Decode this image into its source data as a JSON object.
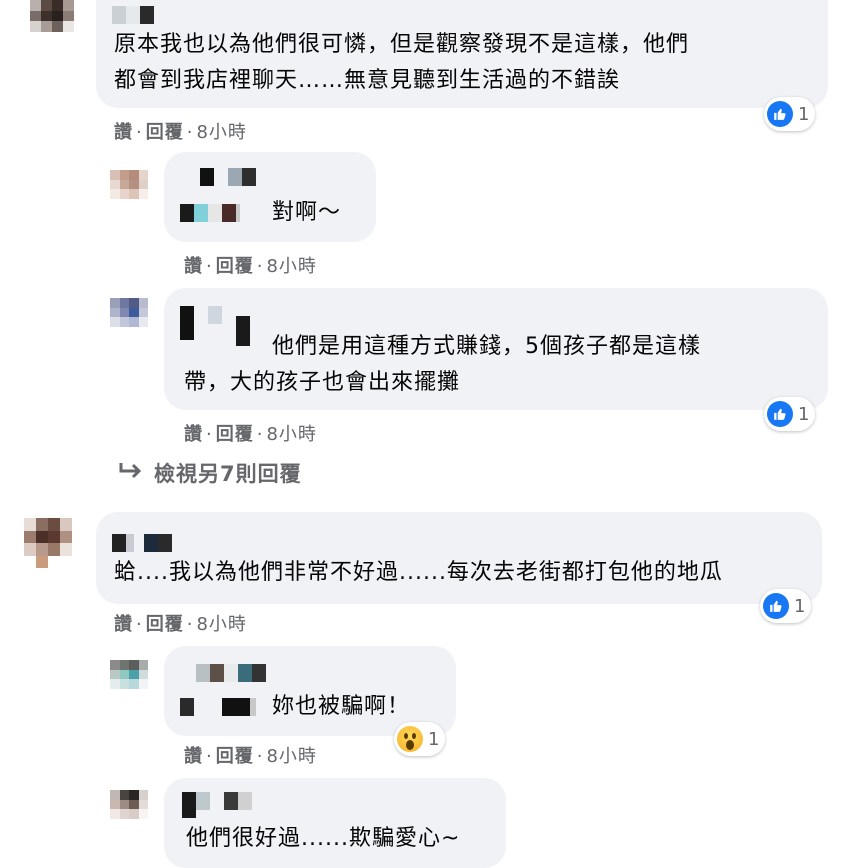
{
  "actions": {
    "like": "讚",
    "reply": "回覆",
    "dot": "·"
  },
  "comments": [
    {
      "line1": "原本我也以為他們很可憐，但是觀察發現不是這樣，他們",
      "line2": "都會到我店裡聊天……無意見聽到生活過的不錯誒",
      "time": "8小時",
      "reaction_icon": "like-icon",
      "reaction_count": "1"
    },
    {
      "line1": "對啊～",
      "time": "8小時"
    },
    {
      "line1": "他們是用這種方式賺錢，5個孩子都是這樣",
      "line2": "帶，大的孩子也會出來擺攤",
      "time": "8小時",
      "reaction_icon": "like-icon",
      "reaction_count": "1"
    },
    {
      "line1": "蛤....我以為他們非常不好過......每次去老街都打包他的地瓜",
      "time": "8小時",
      "reaction_icon": "like-icon",
      "reaction_count": "1"
    },
    {
      "line1": "妳也被騙啊！",
      "time": "8小時",
      "reaction_icon": "wow-icon",
      "reaction_count": "1"
    },
    {
      "line1": "他們很好過......欺騙愛心~"
    }
  ],
  "view_more": {
    "icon": "reply-arrow-icon",
    "label": "檢視另7則回覆"
  },
  "colors": {
    "bubble": "#f0f2f5",
    "like": "#1877f2",
    "secondary_text": "#65676b"
  }
}
